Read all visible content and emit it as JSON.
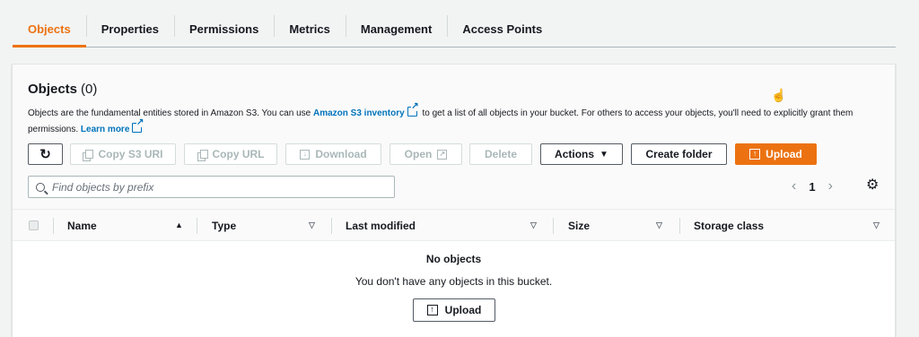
{
  "tabs": [
    {
      "label": "Objects",
      "active": true
    },
    {
      "label": "Properties",
      "active": false
    },
    {
      "label": "Permissions",
      "active": false
    },
    {
      "label": "Metrics",
      "active": false
    },
    {
      "label": "Management",
      "active": false
    },
    {
      "label": "Access Points",
      "active": false
    }
  ],
  "panel": {
    "title": "Objects",
    "count": "(0)",
    "description_1": "Objects are the fundamental entities stored in Amazon S3. You can use ",
    "inventory_link": "Amazon S3 inventory",
    "description_2": " to get a list of all objects in your bucket. For others to access your objects, you'll need to explicitly grant them permissions.",
    "learn_more": "Learn more"
  },
  "toolbar": {
    "refresh_icon": "refresh-icon",
    "copy_s3_uri": "Copy S3 URI",
    "copy_url": "Copy URL",
    "download": "Download",
    "open": "Open",
    "delete": "Delete",
    "actions": "Actions",
    "create_folder": "Create folder",
    "upload": "Upload"
  },
  "search": {
    "placeholder": "Find objects by prefix",
    "value": ""
  },
  "pagination": {
    "current_page": "1"
  },
  "table": {
    "columns": [
      "Name",
      "Type",
      "Last modified",
      "Size",
      "Storage class"
    ],
    "empty_title": "No objects",
    "empty_text": "You don't have any objects in this bucket.",
    "empty_upload": "Upload"
  },
  "colors": {
    "accent": "#ec7211",
    "link": "#0073bb"
  }
}
